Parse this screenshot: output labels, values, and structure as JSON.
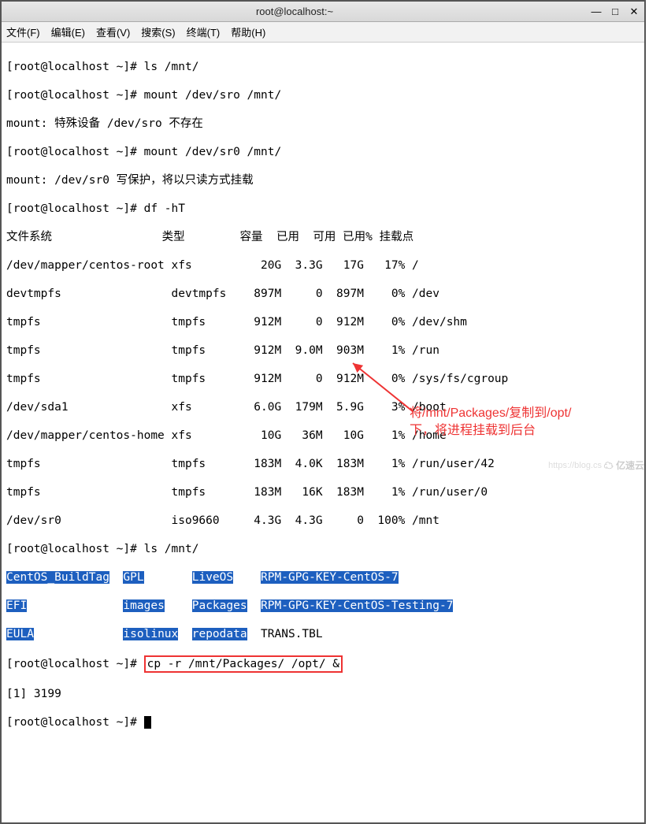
{
  "titlebar": {
    "title": "root@localhost:~"
  },
  "menu": {
    "file": "文件(F)",
    "edit": "编辑(E)",
    "view": "查看(V)",
    "search": "搜索(S)",
    "terminal": "终端(T)",
    "help": "帮助(H)"
  },
  "prompt": "[root@localhost ~]#",
  "cmds": {
    "ls_mnt": "ls /mnt/",
    "mount_sro": "mount /dev/sro /mnt/",
    "mount_sr0": "mount /dev/sr0 /mnt/",
    "df": "df -hT",
    "cp": "cp -r /mnt/Packages/ /opt/ &"
  },
  "msgs": {
    "err_sro": "mount: 特殊设备 /dev/sro 不存在",
    "wp_sr0": "mount: /dev/sr0 写保护，将以只读方式挂载",
    "job": "[1] 3199"
  },
  "df_header": "文件系统                类型        容量  已用  可用 已用% 挂载点",
  "df_rows": [
    "/dev/mapper/centos-root xfs          20G  3.3G   17G   17% /",
    "devtmpfs                devtmpfs    897M     0  897M    0% /dev",
    "tmpfs                   tmpfs       912M     0  912M    0% /dev/shm",
    "tmpfs                   tmpfs       912M  9.0M  903M    1% /run",
    "tmpfs                   tmpfs       912M     0  912M    0% /sys/fs/cgroup",
    "/dev/sda1               xfs         6.0G  179M  5.9G    3% /boot",
    "/dev/mapper/centos-home xfs          10G   36M   10G    1% /home",
    "tmpfs                   tmpfs       183M  4.0K  183M    1% /run/user/42",
    "tmpfs                   tmpfs       183M   16K  183M    1% /run/user/0",
    "/dev/sr0                iso9660     4.3G  4.3G     0  100% /mnt"
  ],
  "mnt_ls": {
    "c1": [
      "CentOS_BuildTag",
      "EFI",
      "EULA"
    ],
    "c2": [
      "GPL",
      "images",
      "isolinux"
    ],
    "c3": [
      "LiveOS",
      "Packages",
      "repodata"
    ],
    "c4": [
      "RPM-GPG-KEY-CentOS-7",
      "RPM-GPG-KEY-CentOS-Testing-7",
      "TRANS.TBL"
    ]
  },
  "annotation": {
    "line1": "将/mnt/Packages/复制到/opt/",
    "line2": "下，将进程挂载到后台"
  },
  "watermark": "https://blog.cs",
  "logo": "亿速云"
}
